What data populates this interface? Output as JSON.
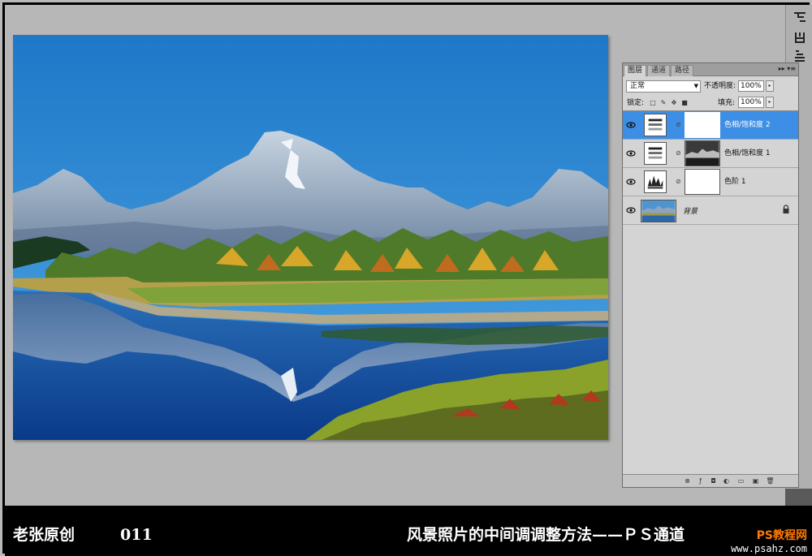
{
  "layers_panel": {
    "tabs": [
      "图层",
      "通道",
      "路径"
    ],
    "blend_mode": "正常",
    "opacity_label": "不透明度:",
    "opacity_value": "100%",
    "lock_label": "锁定:",
    "fill_label": "填充:",
    "fill_value": "100%",
    "layers": [
      {
        "name": "色相/饱和度 2",
        "type": "hue-saturation",
        "visible": true,
        "selected": true
      },
      {
        "name": "色相/饱和度 1",
        "type": "hue-saturation",
        "visible": true,
        "selected": false
      },
      {
        "name": "色阶 1",
        "type": "levels",
        "visible": true,
        "selected": false
      },
      {
        "name": "背景",
        "type": "background",
        "visible": true,
        "selected": false,
        "locked": true
      }
    ]
  },
  "caption": {
    "author": "老张原创",
    "number": "011",
    "title": "风景照片的中间调调整方法——ＰＳ通道"
  },
  "watermark": {
    "site_name": "PS教程网",
    "url": "www.psahz.com"
  },
  "colors": {
    "selected_layer": "#3d8ee5",
    "workspace": "#b7b7b7",
    "caption_bg": "#000000"
  }
}
